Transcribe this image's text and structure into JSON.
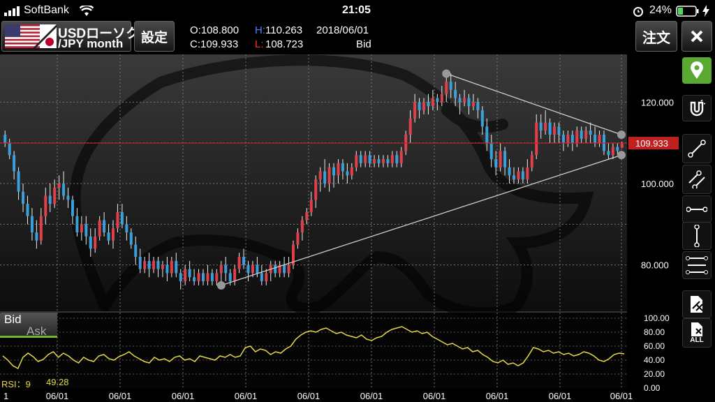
{
  "status_bar": {
    "carrier": "SoftBank",
    "time": "21:05",
    "battery": "24%",
    "icons": [
      "signal-icon",
      "wifi-icon",
      "alarm-icon",
      "battery-icon",
      "charging-icon"
    ]
  },
  "toolbar": {
    "pair_line1": "USDローソク",
    "pair_line2": "/JPY month",
    "settings_label": "設定",
    "order_label": "注文",
    "close_icon": "close-icon"
  },
  "ohlc": {
    "open": "O:108.800",
    "high_prefix": "H:",
    "high": "110.263",
    "date": "2018/06/01",
    "close": "C:109.933",
    "low_prefix": "L:",
    "low": "108.723",
    "side": "Bid"
  },
  "price_axis": {
    "labels": [
      "120.000",
      "100.000",
      "80.000"
    ],
    "current_price": "109.933"
  },
  "rsi_axis": {
    "labels": [
      "100.00",
      "80.00",
      "60.00",
      "40.00",
      "20.00",
      "0.00"
    ]
  },
  "rsi_label": {
    "name": "RSI：9",
    "value": "49.28"
  },
  "bid_ask": {
    "bid": "Bid",
    "ask": "Ask"
  },
  "x_axis": {
    "labels": [
      "1",
      "06/01",
      "06/01",
      "06/01",
      "06/01",
      "06/01",
      "06/01",
      "06/01",
      "06/01",
      "06/01",
      "06/01"
    ]
  },
  "side_tools": [
    {
      "name": "location-pin-icon",
      "active": true
    },
    {
      "name": "magnet-icon",
      "active": false
    },
    {
      "name": "trendline-icon",
      "active": false
    },
    {
      "name": "parallel-line-icon",
      "active": false
    },
    {
      "name": "horizontal-line-icon",
      "active": false
    },
    {
      "name": "vertical-line-icon",
      "active": false
    },
    {
      "name": "fibonacci-lines-icon",
      "active": false
    },
    {
      "name": "delete-drawing-icon",
      "active": false
    },
    {
      "name": "delete-all-icon",
      "active": false,
      "label": "ALL"
    }
  ],
  "colors": {
    "up": "#e0404a",
    "down": "#3aa0dc",
    "rsi": "#e6d84a",
    "current_line": "#c02020",
    "active_tool": "#5aa832"
  },
  "chart_data": {
    "type": "candlestick",
    "yrange": [
      70,
      130
    ],
    "rsi_range": [
      0,
      100
    ],
    "current_price": 109.933,
    "candles": [
      [
        112,
        110,
        113,
        109
      ],
      [
        110,
        107,
        111,
        106
      ],
      [
        107,
        103,
        108,
        101
      ],
      [
        103,
        98,
        104,
        96
      ],
      [
        98,
        95,
        100,
        93
      ],
      [
        95,
        92,
        97,
        90
      ],
      [
        92,
        88,
        94,
        86
      ],
      [
        88,
        86,
        91,
        84
      ],
      [
        86,
        92,
        94,
        85
      ],
      [
        92,
        97,
        99,
        90
      ],
      [
        97,
        95,
        100,
        93
      ],
      [
        95,
        99,
        101,
        94
      ],
      [
        99,
        100,
        102,
        96
      ],
      [
        100,
        97,
        103,
        96
      ],
      [
        97,
        96,
        99,
        94
      ],
      [
        96,
        92,
        97,
        90
      ],
      [
        92,
        88,
        94,
        87
      ],
      [
        88,
        90,
        92,
        86
      ],
      [
        90,
        87,
        92,
        85
      ],
      [
        87,
        84,
        89,
        82
      ],
      [
        84,
        87,
        89,
        83
      ],
      [
        87,
        91,
        92,
        86
      ],
      [
        91,
        88,
        93,
        87
      ],
      [
        88,
        86,
        90,
        85
      ],
      [
        86,
        89,
        91,
        84
      ],
      [
        89,
        93,
        95,
        88
      ],
      [
        93,
        90,
        95,
        89
      ],
      [
        90,
        88,
        92,
        86
      ],
      [
        88,
        85,
        89,
        84
      ],
      [
        85,
        82,
        87,
        80
      ],
      [
        82,
        79,
        84,
        78
      ],
      [
        79,
        81,
        82,
        78
      ],
      [
        81,
        79,
        83,
        77
      ],
      [
        79,
        81,
        82,
        78
      ],
      [
        81,
        79,
        82,
        77
      ],
      [
        79,
        80,
        81,
        77
      ],
      [
        80,
        78,
        82,
        76
      ],
      [
        78,
        81,
        82,
        77
      ],
      [
        81,
        78,
        83,
        77
      ],
      [
        78,
        76,
        79,
        74
      ],
      [
        76,
        79,
        80,
        75
      ],
      [
        79,
        77,
        81,
        76
      ],
      [
        77,
        76,
        79,
        75
      ],
      [
        76,
        78,
        79,
        75
      ],
      [
        78,
        76,
        79,
        75
      ],
      [
        76,
        78,
        80,
        75
      ],
      [
        78,
        76,
        79,
        75
      ],
      [
        76,
        78,
        79,
        75
      ],
      [
        78,
        80,
        81,
        75
      ],
      [
        80,
        78,
        82,
        76
      ],
      [
        78,
        76,
        79,
        75
      ],
      [
        76,
        79,
        80,
        75
      ],
      [
        79,
        82,
        83,
        78
      ],
      [
        82,
        80,
        84,
        79
      ],
      [
        80,
        78,
        81,
        76
      ],
      [
        78,
        80,
        81,
        77
      ],
      [
        80,
        78,
        82,
        77
      ],
      [
        78,
        76,
        80,
        75
      ],
      [
        76,
        78,
        79,
        75
      ],
      [
        78,
        80,
        81,
        76
      ],
      [
        80,
        78,
        81,
        77
      ],
      [
        78,
        80,
        81,
        77
      ],
      [
        80,
        78,
        82,
        77
      ],
      [
        78,
        80,
        82,
        77
      ],
      [
        80,
        85,
        86,
        79
      ],
      [
        85,
        88,
        89,
        84
      ],
      [
        88,
        91,
        92,
        86
      ],
      [
        91,
        93,
        94,
        90
      ],
      [
        93,
        96,
        98,
        92
      ],
      [
        96,
        101,
        102,
        94
      ],
      [
        101,
        103,
        104,
        98
      ],
      [
        103,
        100,
        106,
        99
      ],
      [
        100,
        104,
        105,
        98
      ],
      [
        104,
        102,
        105,
        99
      ],
      [
        102,
        105,
        106,
        100
      ],
      [
        105,
        103,
        106,
        101
      ],
      [
        103,
        102,
        105,
        100
      ],
      [
        102,
        104,
        105,
        101
      ],
      [
        104,
        107,
        108,
        103
      ],
      [
        107,
        105,
        108,
        104
      ],
      [
        105,
        107,
        108,
        104
      ],
      [
        107,
        105,
        108,
        104
      ],
      [
        105,
        106,
        107,
        104
      ],
      [
        106,
        105,
        107,
        104
      ],
      [
        105,
        106,
        107,
        104
      ],
      [
        106,
        105,
        107,
        104
      ],
      [
        105,
        107,
        108,
        104
      ],
      [
        107,
        105,
        108,
        104
      ],
      [
        105,
        108,
        109,
        104
      ],
      [
        108,
        112,
        113,
        107
      ],
      [
        112,
        116,
        118,
        110
      ],
      [
        116,
        120,
        122,
        115
      ],
      [
        120,
        118,
        121,
        116
      ],
      [
        118,
        120,
        121,
        117
      ],
      [
        120,
        119,
        122,
        117
      ],
      [
        119,
        121,
        123,
        118
      ],
      [
        121,
        120,
        122,
        118
      ],
      [
        120,
        122,
        124,
        119
      ],
      [
        122,
        125,
        126,
        120
      ],
      [
        125,
        123,
        127,
        121
      ],
      [
        123,
        121,
        125,
        119
      ],
      [
        121,
        120,
        122,
        117
      ],
      [
        120,
        121,
        123,
        119
      ],
      [
        121,
        119,
        122,
        117
      ],
      [
        119,
        120,
        122,
        118
      ],
      [
        120,
        118,
        121,
        116
      ],
      [
        118,
        114,
        119,
        112
      ],
      [
        114,
        110,
        116,
        108
      ],
      [
        110,
        106,
        112,
        104
      ],
      [
        106,
        104,
        108,
        102
      ],
      [
        104,
        108,
        110,
        103
      ],
      [
        108,
        104,
        109,
        102
      ],
      [
        104,
        102,
        106,
        100
      ],
      [
        102,
        101,
        104,
        100
      ],
      [
        101,
        103,
        104,
        100
      ],
      [
        103,
        101,
        104,
        100
      ],
      [
        101,
        104,
        106,
        100
      ],
      [
        104,
        107,
        108,
        103
      ],
      [
        107,
        115,
        117,
        106
      ],
      [
        115,
        113,
        117,
        111
      ],
      [
        113,
        115,
        118,
        112
      ],
      [
        115,
        112,
        116,
        110
      ],
      [
        112,
        114,
        115,
        110
      ],
      [
        114,
        112,
        115,
        110
      ],
      [
        112,
        110,
        113,
        108
      ],
      [
        110,
        112,
        113,
        109
      ],
      [
        112,
        110,
        113,
        108
      ],
      [
        110,
        113,
        114,
        109
      ],
      [
        113,
        111,
        114,
        110
      ],
      [
        111,
        113,
        114,
        110
      ],
      [
        113,
        112,
        115,
        110
      ],
      [
        112,
        110,
        114,
        109
      ],
      [
        110,
        112,
        113,
        109
      ],
      [
        112,
        108,
        113,
        107
      ],
      [
        108,
        107,
        110,
        106
      ],
      [
        107,
        109,
        110,
        106
      ],
      [
        109,
        108,
        110,
        107
      ],
      [
        108.8,
        109.933,
        110.263,
        108.723
      ]
    ],
    "rsi": [
      46,
      40,
      32,
      28,
      44,
      50,
      45,
      38,
      41,
      48,
      52,
      44,
      50,
      46,
      40,
      36,
      44,
      40,
      38,
      46,
      48,
      42,
      40,
      45,
      48,
      52,
      46,
      42,
      38,
      36,
      44,
      40,
      42,
      38,
      44,
      46,
      40,
      42,
      38,
      46,
      44,
      42,
      40,
      46,
      44,
      48,
      44,
      46,
      58,
      60,
      52,
      56,
      54,
      48,
      52,
      50,
      56,
      60,
      70,
      76,
      80,
      82,
      80,
      84,
      86,
      82,
      78,
      80,
      76,
      74,
      72,
      76,
      70,
      68,
      72,
      74,
      80,
      84,
      86,
      88,
      84,
      80,
      82,
      78,
      80,
      74,
      70,
      66,
      62,
      64,
      60,
      56,
      58,
      52,
      54,
      48,
      44,
      38,
      36,
      40,
      34,
      36,
      32,
      36,
      46,
      58,
      56,
      52,
      54,
      50,
      52,
      48,
      50,
      46,
      48,
      52,
      50,
      46,
      40,
      38,
      42,
      48,
      50,
      49
    ]
  }
}
